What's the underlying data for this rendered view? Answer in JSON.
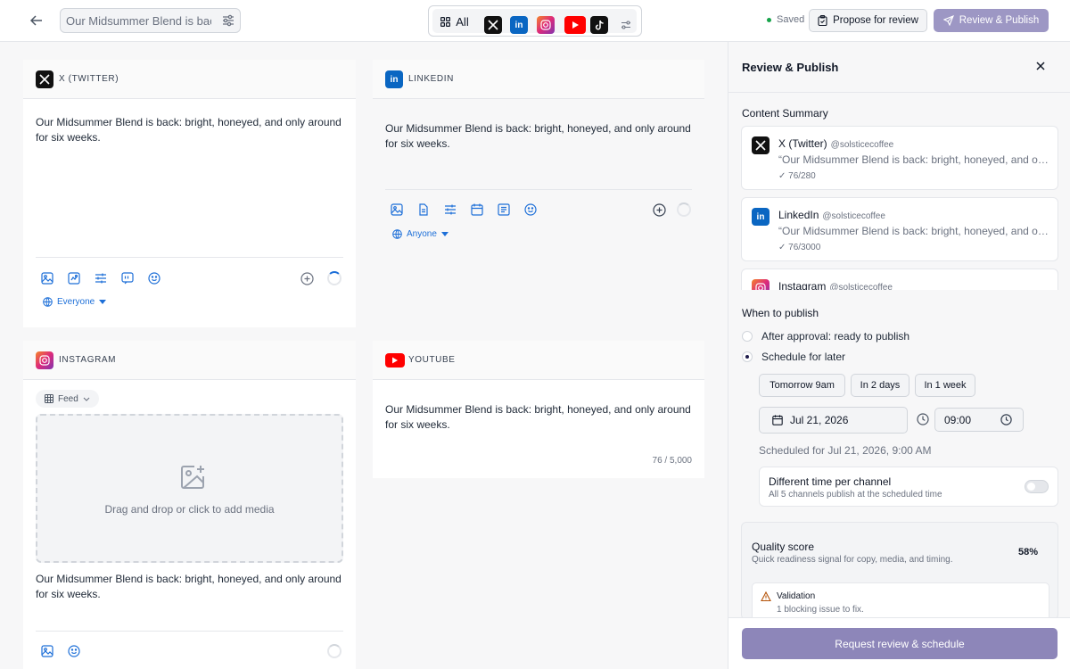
{
  "topbar": {
    "title_value": "Our Midsummer Blend is back:",
    "filter_all_label": "All",
    "saved_label": "Saved",
    "propose_label": "Propose for review",
    "review_label": "Review & Publish"
  },
  "colors": {
    "x": "#111111",
    "linkedin": "#0a66c2",
    "instagram": "#dd2a7b",
    "youtube": "#ff0000",
    "tiktok": "#111111",
    "accent": "#1d6fd8",
    "primary_button": "#9d97c4"
  },
  "cards": {
    "x": {
      "name": "X (TWITTER)",
      "text": "Our Midsummer Blend is back: bright, honeyed, and only around for six weeks.",
      "audience": "Everyone"
    },
    "linkedin": {
      "name": "LINKEDIN",
      "text": "Our Midsummer Blend is back: bright, honeyed, and only around for six weeks.",
      "audience": "Anyone"
    },
    "instagram": {
      "name": "INSTAGRAM",
      "format": "Feed",
      "dropzone": "Drag and drop or click to add media",
      "text": "Our Midsummer Blend is back: bright, honeyed, and only around for six weeks."
    },
    "youtube": {
      "name": "YOUTUBE",
      "text": "Our Midsummer Blend is back: bright, honeyed, and only around for six weeks.",
      "count": "76 / 5,000"
    }
  },
  "panel": {
    "title": "Review & Publish",
    "summary_label": "Content Summary",
    "summary": [
      {
        "name": "X (Twitter)",
        "handle": "@solsticecoffee",
        "text": "“Our Midsummer Blend is back: bright, honeyed, and only around for six weeks.”",
        "count": "✓ 76/280"
      },
      {
        "name": "LinkedIn",
        "handle": "@solsticecoffee",
        "text": "“Our Midsummer Blend is back: bright, honeyed, and only around for six weeks.”",
        "count": "✓ 76/3000"
      },
      {
        "name": "Instagram",
        "handle": "@solsticecoffee",
        "text": "",
        "count": ""
      }
    ],
    "when_label": "When to publish",
    "option_after": "After approval: ready to publish",
    "option_schedule": "Schedule for later",
    "quick": [
      "Tomorrow 9am",
      "In 2 days",
      "In 1 week"
    ],
    "date": "Jul 21, 2026",
    "time": "09:00",
    "scheduled_note": "Scheduled for Jul 21, 2026, 9:00 AM",
    "diff_title": "Different time per channel",
    "diff_sub": "All 5 channels publish at the scheduled time",
    "quality_title": "Quality score",
    "quality_sub": "Quick readiness signal for copy, media, and timing.",
    "quality_score": "58%",
    "validation_title": "Validation",
    "validation_sub": "1 blocking issue to fix.",
    "request_label": "Request review & schedule"
  }
}
